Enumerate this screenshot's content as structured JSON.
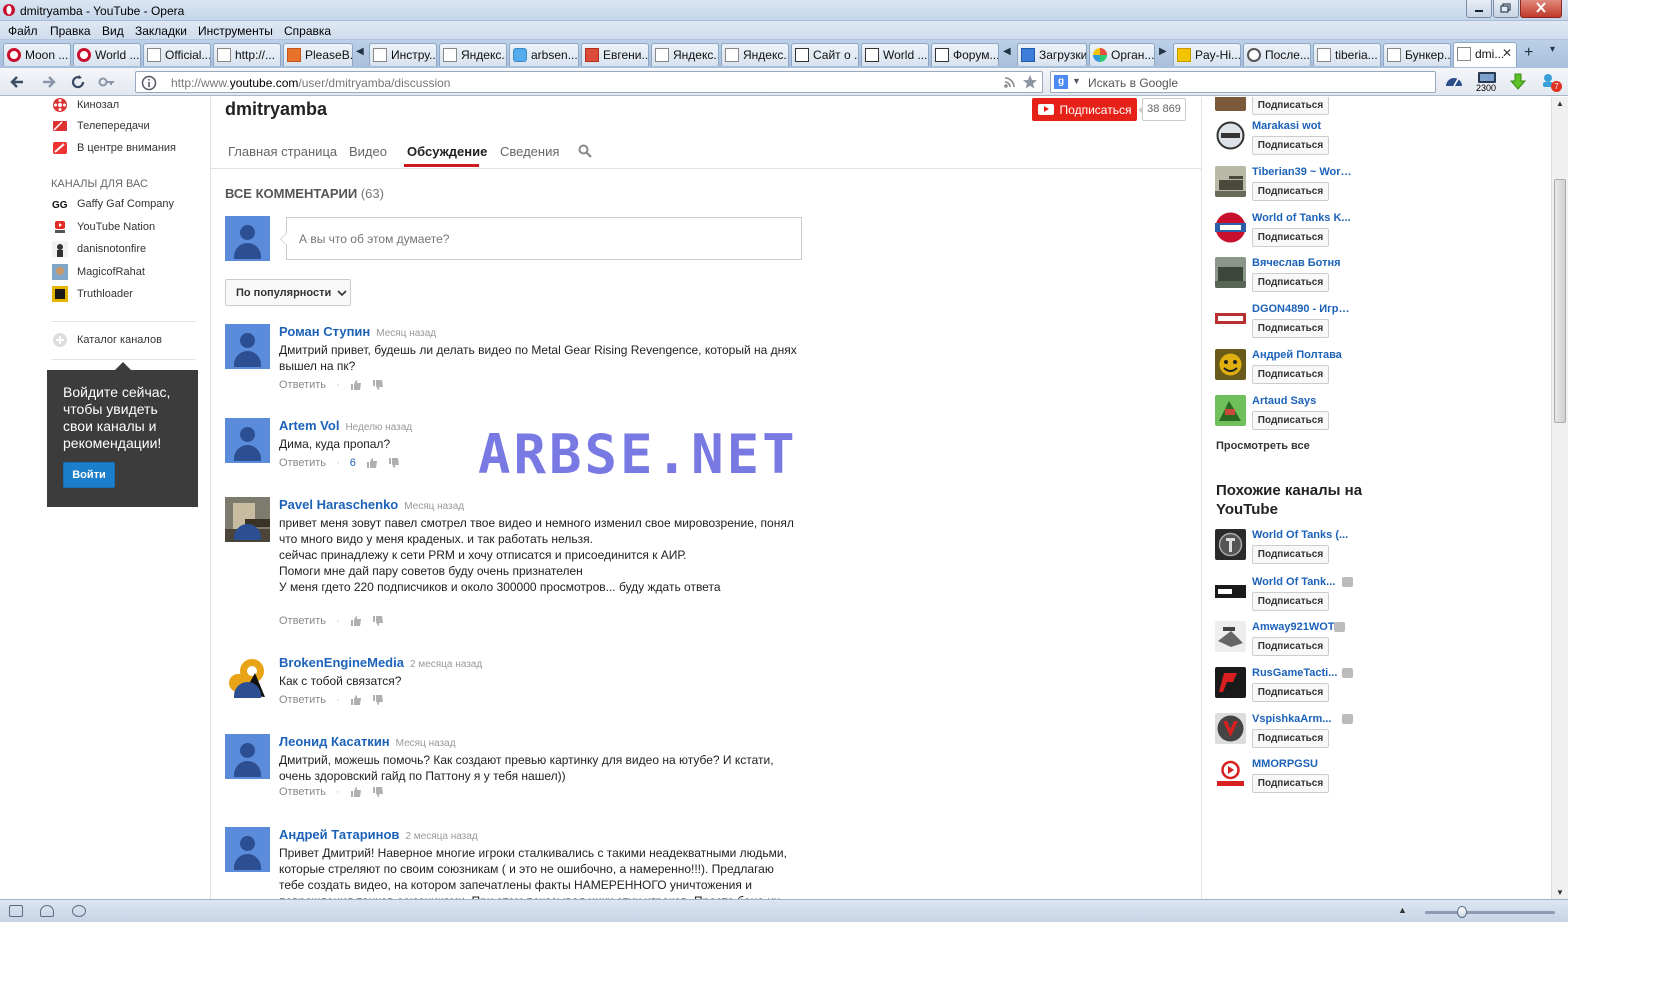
{
  "window": {
    "title": "dmitryamba - YouTube - Opera"
  },
  "menu": [
    "Файл",
    "Правка",
    "Вид",
    "Закладки",
    "Инструменты",
    "Справка"
  ],
  "tabs": [
    {
      "label": "Moon ...",
      "icon": "opera"
    },
    {
      "label": "World ...",
      "icon": "opera"
    },
    {
      "label": "Official...",
      "icon": "page"
    },
    {
      "label": "http://...",
      "icon": "page"
    },
    {
      "label": "PleaseB...",
      "icon": "blogger"
    },
    {
      "label": "Инстру...",
      "icon": "page"
    },
    {
      "label": "Яндекс...",
      "icon": "page"
    },
    {
      "label": "arbsen...",
      "icon": "twitter"
    },
    {
      "label": "Евгени...",
      "icon": "google-plus"
    },
    {
      "label": "Яндекс...",
      "icon": "page"
    },
    {
      "label": "Яндекс...",
      "icon": "page"
    },
    {
      "label": "Сайт о ...",
      "icon": "bse"
    },
    {
      "label": "World ...",
      "icon": "bse"
    },
    {
      "label": "Форум...",
      "icon": "bse"
    },
    {
      "label": "Загрузки",
      "icon": "downloads"
    },
    {
      "label": "Орган...",
      "icon": "multicolor"
    },
    {
      "label": "Pay-Hi...",
      "icon": "pay"
    },
    {
      "label": "После...",
      "icon": "circle"
    },
    {
      "label": "tiberia...",
      "icon": "page"
    },
    {
      "label": "Бункер...",
      "icon": "page"
    },
    {
      "label": "dmi...",
      "icon": "youtube",
      "active": true
    }
  ],
  "address": {
    "prefix": "http://www.",
    "domain": "youtube.com",
    "path": "/user/dmitryamba/discussion"
  },
  "search": {
    "placeholder": "Искать в Google"
  },
  "toolbar_badges": {
    "counter": "2300",
    "notify": "7"
  },
  "guide": {
    "top_items": [
      "Кинозал",
      "Телепередачи",
      "В центре внимания"
    ],
    "section_title": "Каналы для вас",
    "channels": [
      "Gaffy Gaf Company",
      "YouTube Nation",
      "danisnotonfire",
      "MagicofRahat",
      "Truthloader"
    ],
    "catalog": "Каталог каналов",
    "signin_prompt": "Войдите сейчас, чтобы увидеть свои каналы и рекомендации!",
    "signin_button": "Войти"
  },
  "channel": {
    "name": "dmitryamba",
    "subscribe": "Подписаться",
    "subscribers": "38 869",
    "tabs": [
      "Главная страница",
      "Видео",
      "Обсуждение",
      "Сведения"
    ],
    "active_tab": "Обсуждение"
  },
  "discussion": {
    "heading": "ВСЕ КОММЕНТАРИИ",
    "count": "(63)",
    "input_placeholder": "А вы что об этом думаете?",
    "sort": "По популярности",
    "reply": "Ответить",
    "comments": [
      {
        "author": "Роман Ступин",
        "time": "Месяц назад",
        "text": "Дмитрий привет, будешь ли делать видео по Metal Gear Rising Revengence, который на днях вышел на пк?",
        "likes": ""
      },
      {
        "author": "Artem Vol",
        "time": "Неделю назад",
        "text": "Дима, куда пропал?",
        "likes": "6"
      },
      {
        "author": "Pavel Haraschenko",
        "time": "Месяц назад",
        "text": "привет меня зовут павел смотрел твое видео и немного изменил свое мировозрение, понял что много видо у меня краденых. и так работать нельзя.\nсейчас принадлежу к сети PRM и хочу отписатся и присоединится к АИР.\nПомоги мне дай пару советов буду очень признателен\n У меня гдето 220 подписчиков и около 300000 просмотров... буду ждать ответа",
        "likes": ""
      },
      {
        "author": "BrokenEngineMedia",
        "time": "2 месяца назад",
        "text": "Как с тобой связатся?",
        "likes": ""
      },
      {
        "author": "Леонид Касаткин",
        "time": "Месяц назад",
        "text": "Дмитрий, можешь помочь? Как создают превью картинку для видео на ютубе? И кстати, очень здоровский гайд по Паттону я у тебя нашел))",
        "likes": ""
      },
      {
        "author": "Андрей Татаринов",
        "time": "2 месяца назад",
        "text": "Привет Дмитрий! Наверное многие игроки сталкивались с такими неадекватными людьми, которые стреляют по своим союзникам ( и это не ошибочно, а намеренно!!!). Предлагаю тебе создать видео, на котором запечатлены факты НАМЕРЕННОГО уничтожения и повреждения танков союзниками. При этом показывая ники этих игроков. Просто бана их",
        "likes": ""
      }
    ]
  },
  "watermark": "ARBSE.NET",
  "sidebar_right": {
    "subscribe": "Подписаться",
    "channels": [
      {
        "name": "Marakasi wot",
        "verified": false,
        "thumb": "#dde3e8"
      },
      {
        "name": "Tiberian39 ~ Worl...",
        "verified": false,
        "thumb": "#8a8f6a"
      },
      {
        "name": "World of Tanks K...",
        "verified": false,
        "thumb": "#2b5fa8"
      },
      {
        "name": "Вячеслав Ботня",
        "verified": false,
        "thumb": "#6f7d6a"
      },
      {
        "name": "DGON4890 - Игро...",
        "verified": false,
        "thumb": "#b83030"
      },
      {
        "name": "Андрей Полтава",
        "verified": false,
        "thumb": "#e0b010"
      },
      {
        "name": "Artaud Says",
        "verified": false,
        "thumb": "#5aa04a"
      }
    ],
    "see_all": "Просмотреть все",
    "similar_title": "Похожие каналы на YouTube",
    "similar": [
      {
        "name": "World Of Tanks (...",
        "verified": false,
        "thumb": "#2a2a2a"
      },
      {
        "name": "World Of Tank...",
        "verified": true,
        "thumb": "#1a1a1a"
      },
      {
        "name": "Amway921WOT",
        "verified": true,
        "thumb": "#c9c9c9"
      },
      {
        "name": "RusGameTacti...",
        "verified": true,
        "thumb": "#1a1a1a"
      },
      {
        "name": "VspishkaArm...",
        "verified": true,
        "thumb": "#cfcfcf"
      },
      {
        "name": "MMORPGSU",
        "verified": false,
        "thumb": "#ffffff"
      }
    ]
  }
}
